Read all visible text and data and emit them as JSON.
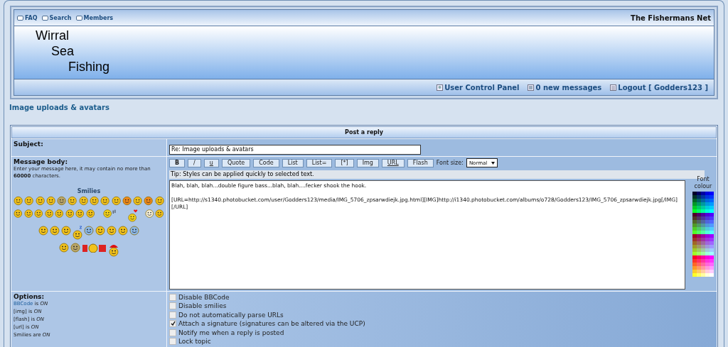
{
  "nav_links": [
    {
      "label": "FAQ"
    },
    {
      "label": "Search"
    },
    {
      "label": "Members"
    }
  ],
  "site_name": "The Fishermans Net",
  "logo_lines": [
    "Wirral",
    "Sea",
    "Fishing"
  ],
  "user_links": [
    {
      "kind": "user",
      "label": "User Control Panel"
    },
    {
      "kind": "messages",
      "label": "0 new messages"
    },
    {
      "kind": "logout",
      "label": "Logout [ Godders123 ]"
    }
  ],
  "topic_title": "Image uploads & avatars",
  "form": {
    "heading": "Post a reply",
    "subject": {
      "label": "Subject:",
      "value": "Re: Image uploads & avatars"
    },
    "message": {
      "label": "Message body:",
      "hint": "Enter your message here, it may contain no more than **60000** characters.",
      "smilies_title": "Smilies",
      "smilies": [
        [
          {
            "kind": "yellow"
          },
          {
            "kind": "yellow"
          },
          {
            "kind": "yellow"
          },
          {
            "kind": "yellow"
          },
          {
            "kind": "grey"
          },
          {
            "kind": "yellow"
          },
          {
            "kind": "yellow"
          },
          {
            "kind": "yellow"
          },
          {
            "kind": "yellow"
          },
          {
            "kind": "yellow"
          },
          {
            "kind": "orange"
          },
          {
            "kind": "yellow"
          },
          {
            "kind": "orange"
          },
          {
            "kind": "yellow"
          }
        ],
        [
          {
            "kind": "yellow"
          },
          {
            "kind": "yellow"
          },
          {
            "kind": "yellow"
          },
          {
            "kind": "yellow"
          },
          {
            "kind": "yellow"
          },
          {
            "kind": "yellow"
          },
          {
            "kind": "yellow"
          },
          {
            "kind": "yellow"
          },
          {
            "kind": "music"
          },
          {
            "kind": "hearts"
          },
          {
            "kind": "pale"
          },
          {
            "kind": "yellow"
          }
        ],
        [
          {
            "kind": "yellow"
          },
          {
            "kind": "yellow"
          },
          {
            "kind": "yellow"
          },
          {
            "kind": "sleep"
          },
          {
            "kind": "blue"
          },
          {
            "kind": "yellow"
          },
          {
            "kind": "yellow"
          },
          {
            "kind": "yellow"
          },
          {
            "kind": "blue"
          }
        ],
        [
          {
            "kind": "yellow"
          },
          {
            "kind": "grey"
          },
          {
            "kind": "rofl"
          },
          {
            "kind": "santa"
          }
        ]
      ],
      "buttons": [
        {
          "label": "B",
          "kind": "bold"
        },
        {
          "label": "/",
          "kind": "plain"
        },
        {
          "label": "u",
          "kind": "underline"
        },
        {
          "label": "Quote",
          "kind": "plain"
        },
        {
          "label": "Code",
          "kind": "plain"
        },
        {
          "label": "List",
          "kind": "plain"
        },
        {
          "label": "List=",
          "kind": "plain"
        },
        {
          "label": "[*]",
          "kind": "plain"
        },
        {
          "label": "Img",
          "kind": "plain"
        },
        {
          "label": "URL",
          "kind": "underline"
        },
        {
          "label": "Flash",
          "kind": "plain"
        }
      ],
      "font_size_label": "Font size:",
      "font_size": "Normal",
      "tip": "Tip: Styles can be applied quickly to selected text.",
      "body": "Blah, blah, blah...double figure bass...blah, blah....fecker shook the hook.\n\n[URL=http://s1340.photobucket.com/user/Godders123/media/IMG_5706_zpsarwdiejk.jpg.html][IMG]http://i1340.photobucket.com/albums/o728/Godders123/IMG_5706_zpsarwdiejk.jpg[/IMG][/URL]",
      "colour_label": "Font colour"
    },
    "options": {
      "label": "Options:",
      "status": [
        {
          "name": "BBCode",
          "verb": "is",
          "value": "ON"
        },
        {
          "name": "[img]",
          "verb": "is",
          "value": "ON"
        },
        {
          "name": "[flash]",
          "verb": "is",
          "value": "ON"
        },
        {
          "name": "[url]",
          "verb": "is",
          "value": "ON"
        },
        {
          "name": "Smilies",
          "verb": "are",
          "value": "ON"
        }
      ],
      "checkboxes": [
        {
          "label": "Disable BBCode",
          "checked": false
        },
        {
          "label": "Disable smilies",
          "checked": false
        },
        {
          "label": "Do not automatically parse URLs",
          "checked": false
        },
        {
          "label": "Attach a signature (signatures can be altered via the UCP)",
          "checked": true
        },
        {
          "label": "Notify me when a reply is posted",
          "checked": false
        },
        {
          "label": "Lock topic",
          "checked": false
        }
      ]
    }
  }
}
